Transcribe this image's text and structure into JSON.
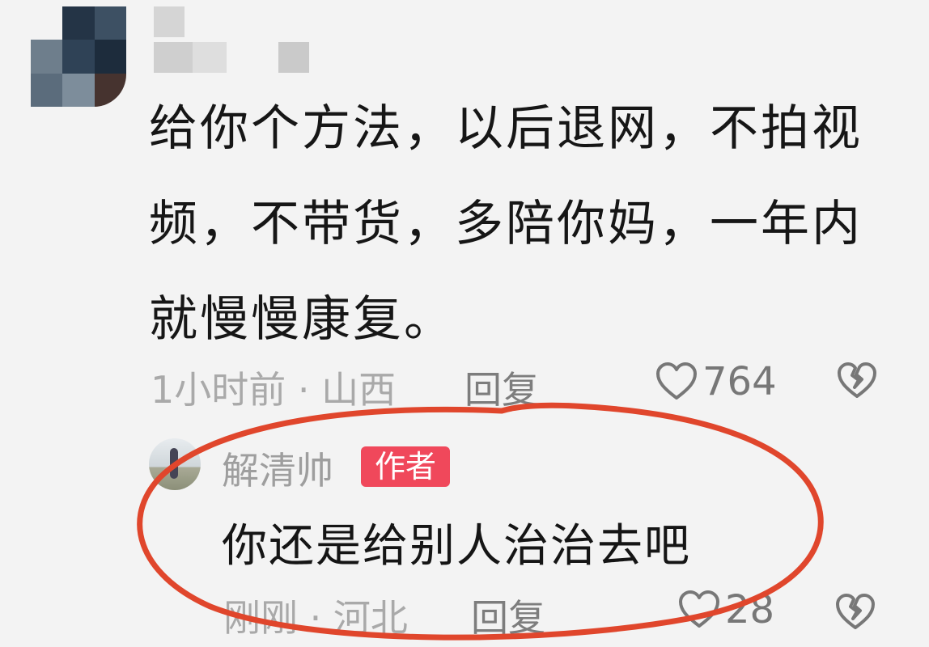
{
  "comment": {
    "text": "给你个方法，以后退网，不拍视频，不带货，多陪你妈，一年内就慢慢康复。",
    "time_location": "1小时前 · 山西",
    "reply_label": "回复",
    "like_count": "764",
    "icons": {
      "like": "heart-outline-icon",
      "dislike": "broken-heart-icon"
    }
  },
  "reply": {
    "username": "解清帅",
    "badge": "作者",
    "text": "你还是给别人治治去吧",
    "time_location": "刚刚 · 河北",
    "reply_label": "回复",
    "like_count": "28"
  },
  "colors": {
    "background": "#f3f3f3",
    "badge": "#f0485b",
    "annotation": "#e0462c"
  }
}
